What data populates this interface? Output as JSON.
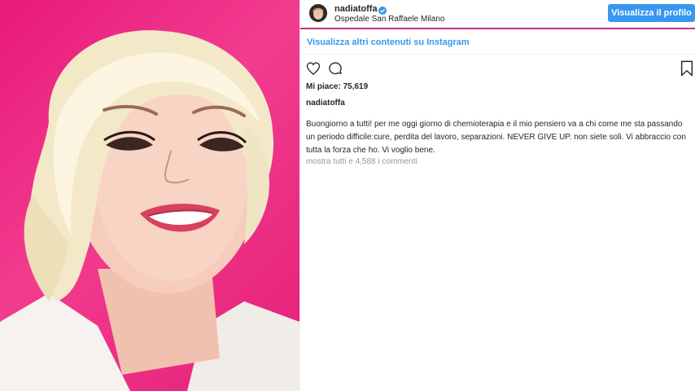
{
  "header": {
    "username": "nadiatoffa",
    "location": "Ospedale San Raffaele Milano",
    "profile_button_label": "Visualizza il profilo"
  },
  "more_content_label": "Visualizza altri contenuti su Instagram",
  "post": {
    "likes_text": "Mi piace: 75,619",
    "caption_username": "nadiatoffa",
    "caption_text": "Buongiorno a tutti! per me oggi giorno di chemioterapia e il mio pensiero va a chi come me sta passando un periodo difficile:cure, perdita del lavoro, separazioni. NEVER GIVE UP. non siete soli. Vi abbraccio con tutta la forza che ho. Vi voglio bene.",
    "comments_link": "mostra tutti e 4,588 i commenti"
  },
  "icons": [
    "verified-badge-icon",
    "heart-icon",
    "comment-icon",
    "bookmark-icon"
  ],
  "colors": {
    "accent_blue": "#3897f0",
    "photo_background": "#e8197a",
    "header_border": "#c13584"
  }
}
